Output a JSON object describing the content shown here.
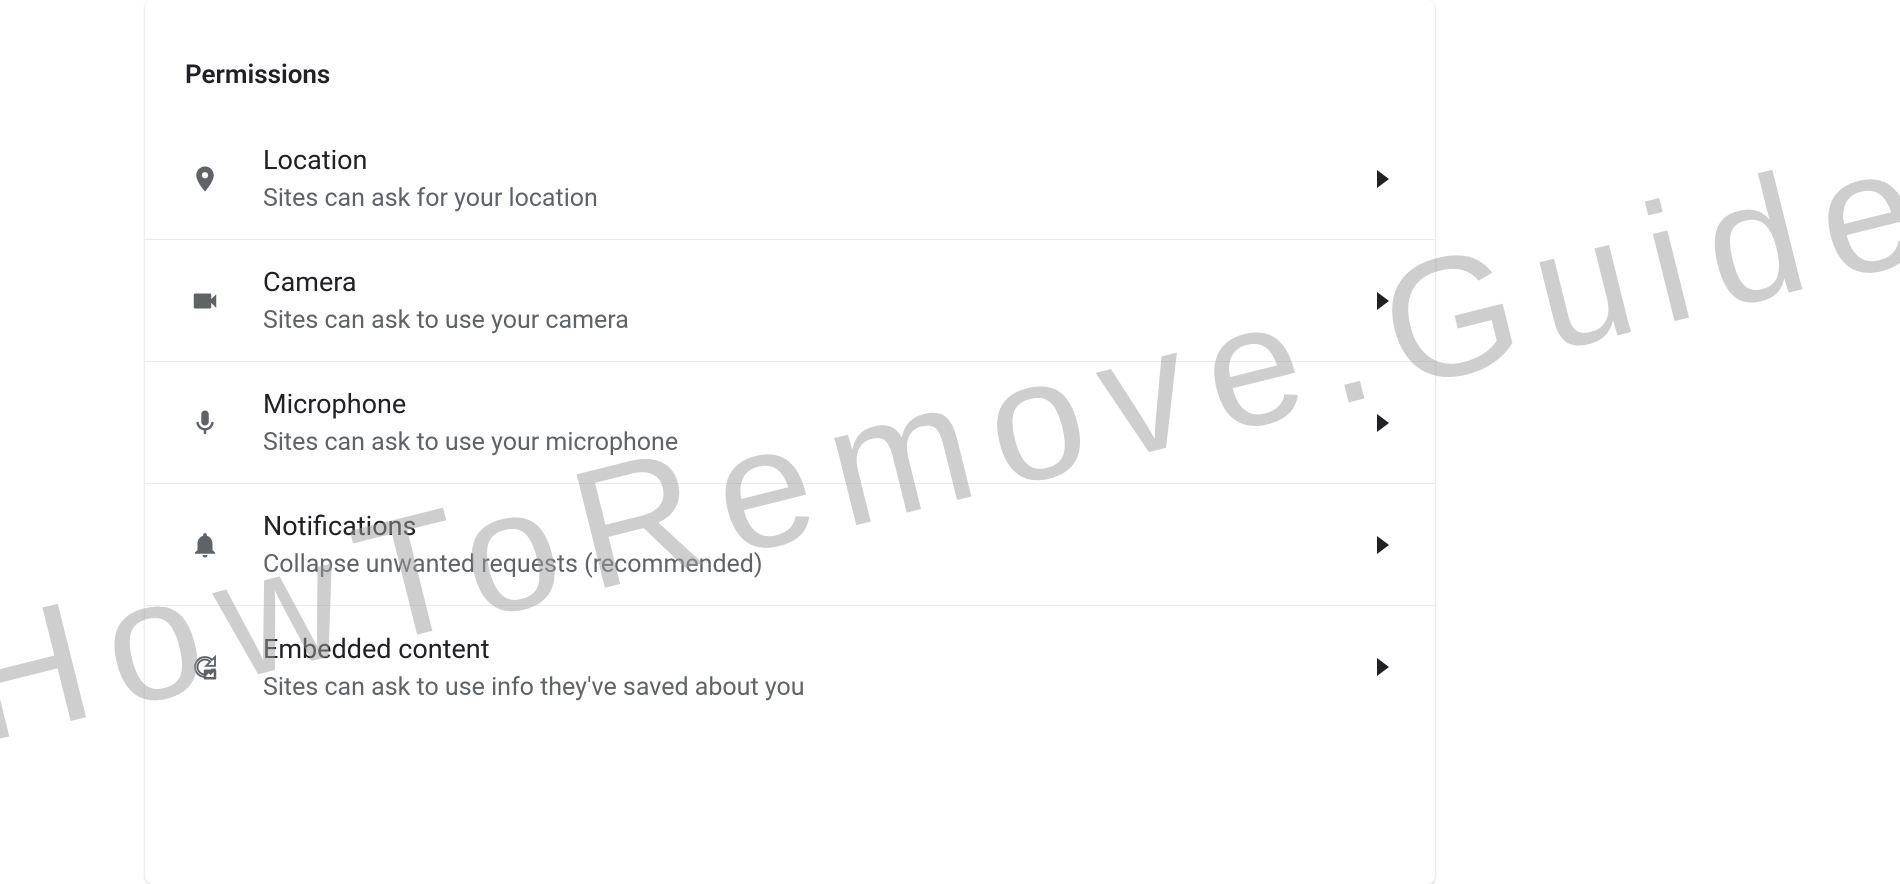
{
  "section_title": "Permissions",
  "permissions": [
    {
      "title": "Location",
      "subtitle": "Sites can ask for your location"
    },
    {
      "title": "Camera",
      "subtitle": "Sites can ask to use your camera"
    },
    {
      "title": "Microphone",
      "subtitle": "Sites can ask to use your microphone"
    },
    {
      "title": "Notifications",
      "subtitle": "Collapse unwanted requests (recommended)"
    },
    {
      "title": "Embedded content",
      "subtitle": "Sites can ask to use info they've saved about you"
    }
  ],
  "watermark": "HowToRemove.Guide"
}
